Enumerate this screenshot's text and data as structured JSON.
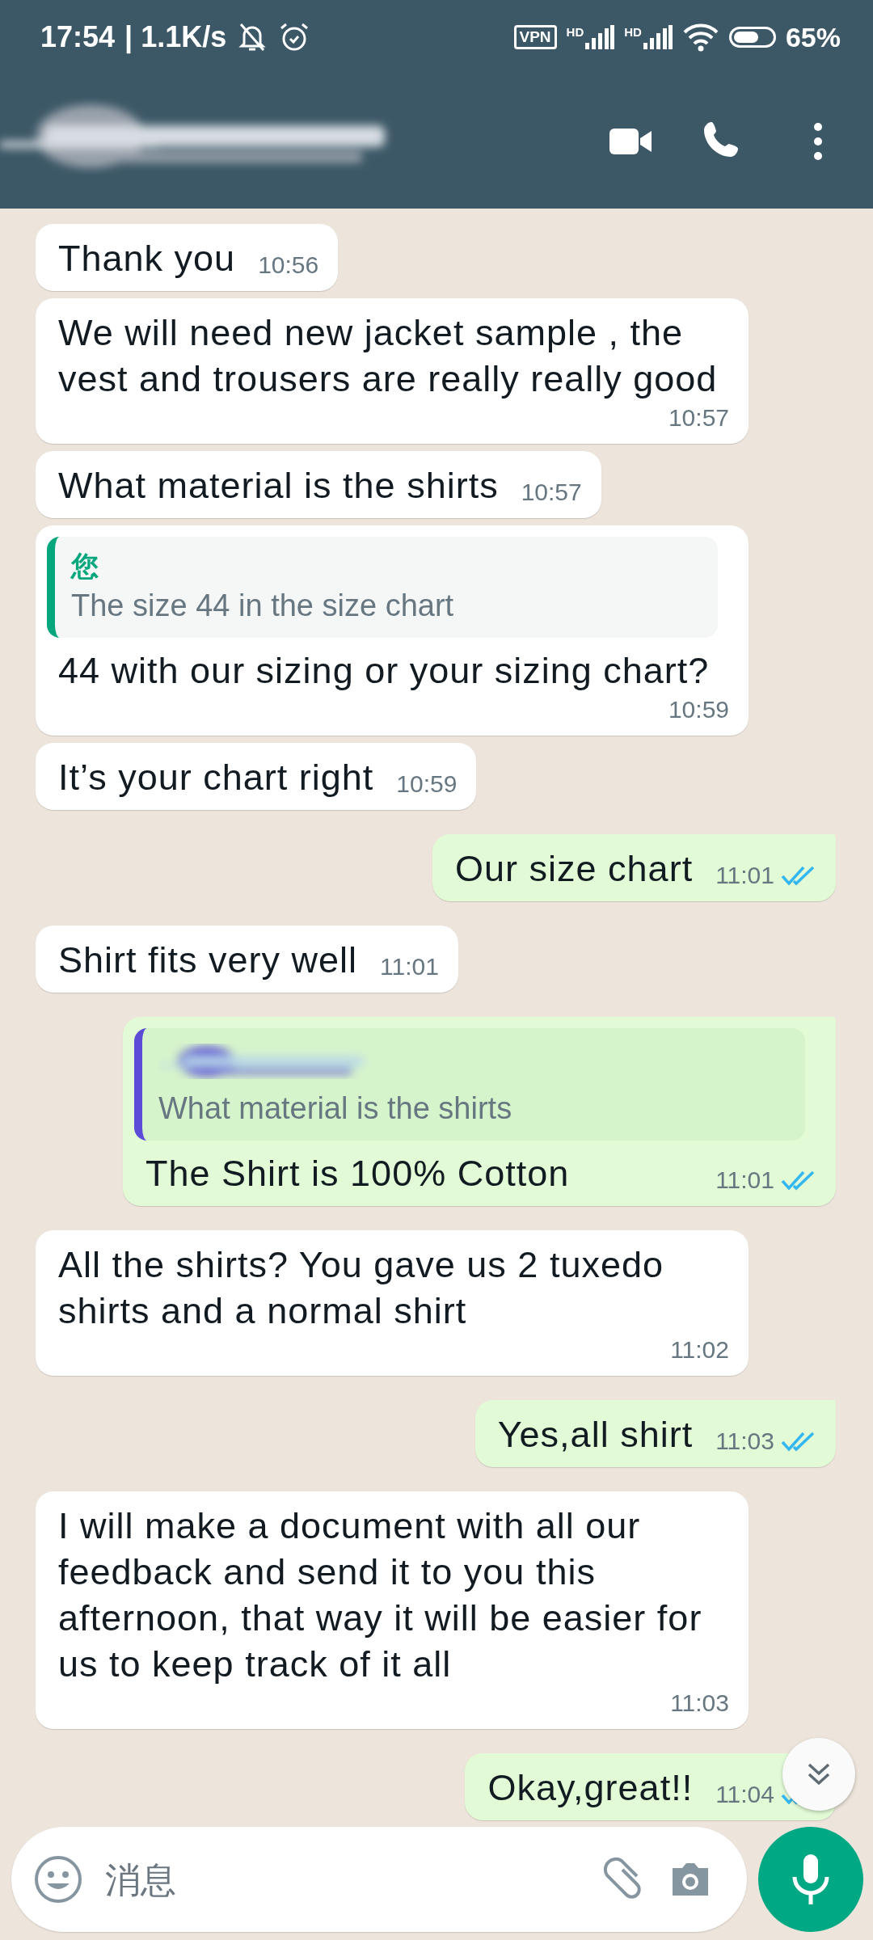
{
  "status_bar": {
    "time": "17:54",
    "speed": "| 1.1K/s",
    "vpn": "VPN",
    "signal_labels": [
      "HD",
      "HD"
    ],
    "battery": "65%"
  },
  "messages": [
    {
      "outgoing": false,
      "text": "Thank you",
      "time": "10:56"
    },
    {
      "outgoing": false,
      "text": "We will need new jacket sample , the vest and trousers are really really good",
      "time": "10:57"
    },
    {
      "outgoing": false,
      "text": "What material is the shirts",
      "time": "10:57"
    },
    {
      "outgoing": false,
      "quote": {
        "author": "您",
        "text": "The size 44 in the size chart",
        "color": "#06a77d"
      },
      "text": "44 with our sizing or your sizing chart?",
      "time": "10:59"
    },
    {
      "outgoing": false,
      "text": "It’s your chart right",
      "time": "10:59"
    },
    {
      "outgoing": true,
      "text": "Our size chart",
      "time": "11:01",
      "read": true
    },
    {
      "outgoing": false,
      "text": "Shirt fits very well",
      "time": "11:01"
    },
    {
      "outgoing": true,
      "quote": {
        "text": "What material is the shirts",
        "color": "#5b4bd6"
      },
      "text": "The Shirt is 100% Cotton",
      "time": "11:01",
      "read": true
    },
    {
      "outgoing": false,
      "text": "All the shirts? You gave us 2 tuxedo shirts and a normal shirt",
      "time": "11:02"
    },
    {
      "outgoing": true,
      "text": "Yes,all shirt",
      "time": "11:03",
      "read": true
    },
    {
      "outgoing": false,
      "text": "I will make a document with all our feedback and send it to you this afternoon, that way it will be easier for us to keep track of it all",
      "time": "11:03"
    },
    {
      "outgoing": true,
      "text": "Okay,great!!",
      "time": "11:04",
      "read": true
    }
  ],
  "composer": {
    "placeholder": "消息"
  }
}
